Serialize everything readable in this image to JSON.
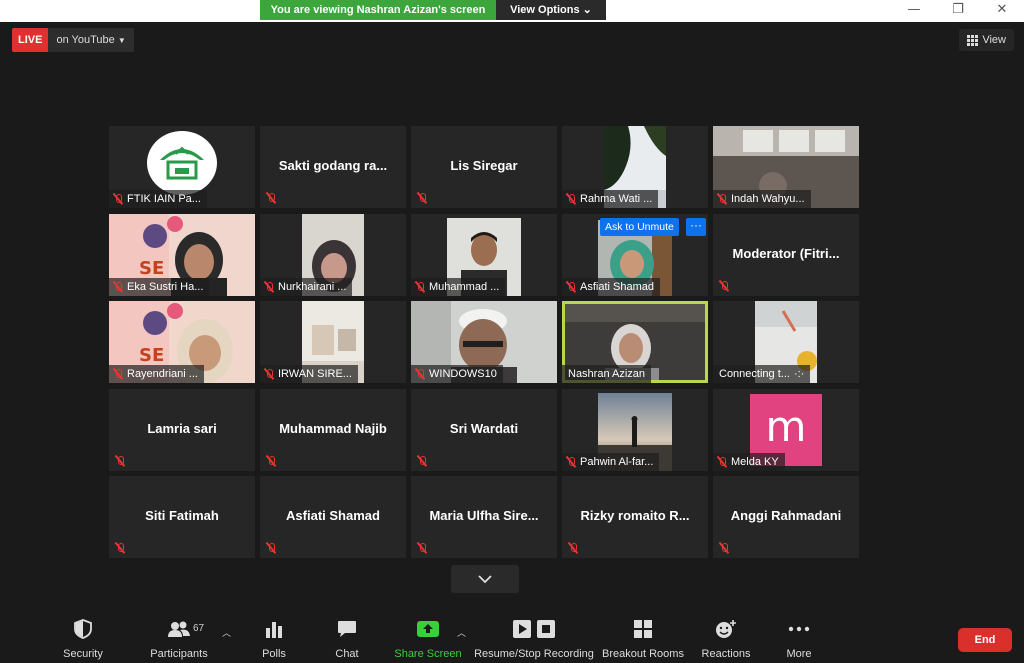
{
  "share_banner": {
    "text": "You are viewing Nashran Azizan's screen",
    "options_label": "View Options"
  },
  "window_controls": {
    "minimize": "—",
    "restore": "❐",
    "close": "✕"
  },
  "live": {
    "badge": "LIVE",
    "destination": "on YouTube"
  },
  "view_button": {
    "label": "View"
  },
  "participants": [
    {
      "label": "FTIK IAIN Pa...",
      "type": "logo"
    },
    {
      "label": "Sakti godang ra...",
      "type": "name"
    },
    {
      "label": "Lis Siregar",
      "type": "name"
    },
    {
      "label": "Rahma Wati ...",
      "type": "video"
    },
    {
      "label": "Indah Wahyu...",
      "type": "video"
    },
    {
      "label": "Eka Sustri Ha...",
      "type": "video"
    },
    {
      "label": "Nurkhairani ...",
      "type": "video"
    },
    {
      "label": "Muhammad ...",
      "type": "video"
    },
    {
      "label": "Asfiati Shamad",
      "type": "video",
      "ask_unmute": "Ask to Unmute",
      "more": "···"
    },
    {
      "label": "Moderator (Fitri...",
      "type": "name"
    },
    {
      "label": "Rayendriani ...",
      "type": "video"
    },
    {
      "label": "IRWAN SIRE...",
      "type": "video"
    },
    {
      "label": "WINDOWS10",
      "type": "video"
    },
    {
      "label": "Nashran Azizan",
      "type": "video",
      "active": true
    },
    {
      "label": "Connecting t...",
      "type": "video",
      "connecting_dots": "·:·"
    },
    {
      "label": "Lamria sari",
      "type": "name"
    },
    {
      "label": "Muhammad Najib",
      "type": "name"
    },
    {
      "label": "Sri Wardati",
      "type": "name"
    },
    {
      "label": "Pahwin Al-far...",
      "type": "video"
    },
    {
      "label": "Melda KY",
      "type": "avatar",
      "initial": "m"
    },
    {
      "label": "Siti Fatimah",
      "type": "name"
    },
    {
      "label": "Asfiati Shamad",
      "type": "name"
    },
    {
      "label": "Maria Ulfha Sire...",
      "type": "name"
    },
    {
      "label": "Rizky romaito R...",
      "type": "name"
    },
    {
      "label": "Anggi Rahmadani",
      "type": "name"
    }
  ],
  "toolbar": {
    "security": "Security",
    "participants": "Participants",
    "participant_count": "67",
    "polls": "Polls",
    "chat": "Chat",
    "share_screen": "Share Screen",
    "recording": "Resume/Stop Recording",
    "breakout": "Breakout Rooms",
    "reactions": "Reactions",
    "more": "More",
    "end": "End"
  },
  "colors": {
    "share_green": "#3ca63c",
    "live_red": "#e0302f",
    "active_outline": "#b8d84a",
    "ask_blue": "#0e72ed",
    "avatar_pink": "#e0437f",
    "end_red": "#d9302b"
  }
}
